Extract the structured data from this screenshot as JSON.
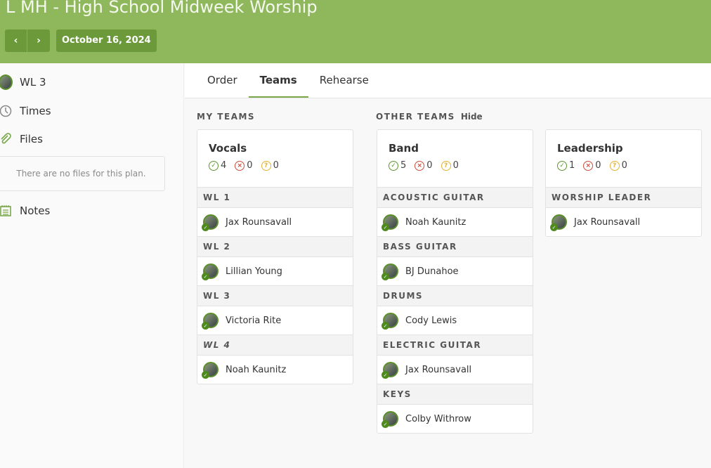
{
  "header": {
    "title": "L MH - High School Midweek Worship",
    "prev_icon": "‹",
    "next_icon": "›",
    "date": "October 16, 2024"
  },
  "sidebar": {
    "items": [
      {
        "label": "WL 3",
        "icon": "avatar"
      },
      {
        "label": "Times",
        "icon": "clock-icon"
      },
      {
        "label": "Files",
        "icon": "paperclip-icon"
      },
      {
        "label": "Notes",
        "icon": "notepad-icon"
      }
    ],
    "no_files": "There are no files for this plan."
  },
  "tabs": [
    "Order",
    "Teams",
    "Rehearse"
  ],
  "my_teams_label": "MY TEAMS",
  "other_teams_label": "OTHER TEAMS",
  "hide_label": "Hide",
  "colors": {
    "header": "#8fb85c",
    "button": "#6c9a3b",
    "confirmed": "#5a9a2a",
    "declined": "#cc4a3a",
    "pending": "#e8b030"
  },
  "teams": [
    {
      "name": "Vocals",
      "confirmed": "4",
      "declined": "0",
      "pending": "0",
      "positions": [
        {
          "name": "WL 1",
          "people": [
            "Jax Rounsavall"
          ]
        },
        {
          "name": "WL 2",
          "people": [
            "Lillian Young"
          ]
        },
        {
          "name": "WL 3",
          "people": [
            "Victoria Rite"
          ]
        },
        {
          "name": "WL 4",
          "people": [
            "Noah Kaunitz"
          ]
        }
      ]
    },
    {
      "name": "Band",
      "confirmed": "5",
      "declined": "0",
      "pending": "0",
      "positions": [
        {
          "name": "ACOUSTIC GUITAR",
          "people": [
            "Noah Kaunitz"
          ]
        },
        {
          "name": "BASS GUITAR",
          "people": [
            "BJ Dunahoe"
          ]
        },
        {
          "name": "DRUMS",
          "people": [
            "Cody Lewis"
          ]
        },
        {
          "name": "ELECTRIC GUITAR",
          "people": [
            "Jax Rounsavall"
          ]
        },
        {
          "name": "KEYS",
          "people": [
            "Colby Withrow"
          ]
        }
      ]
    },
    {
      "name": "Leadership",
      "confirmed": "1",
      "declined": "0",
      "pending": "0",
      "positions": [
        {
          "name": "WORSHIP LEADER",
          "people": [
            "Jax Rounsavall"
          ]
        }
      ]
    }
  ]
}
